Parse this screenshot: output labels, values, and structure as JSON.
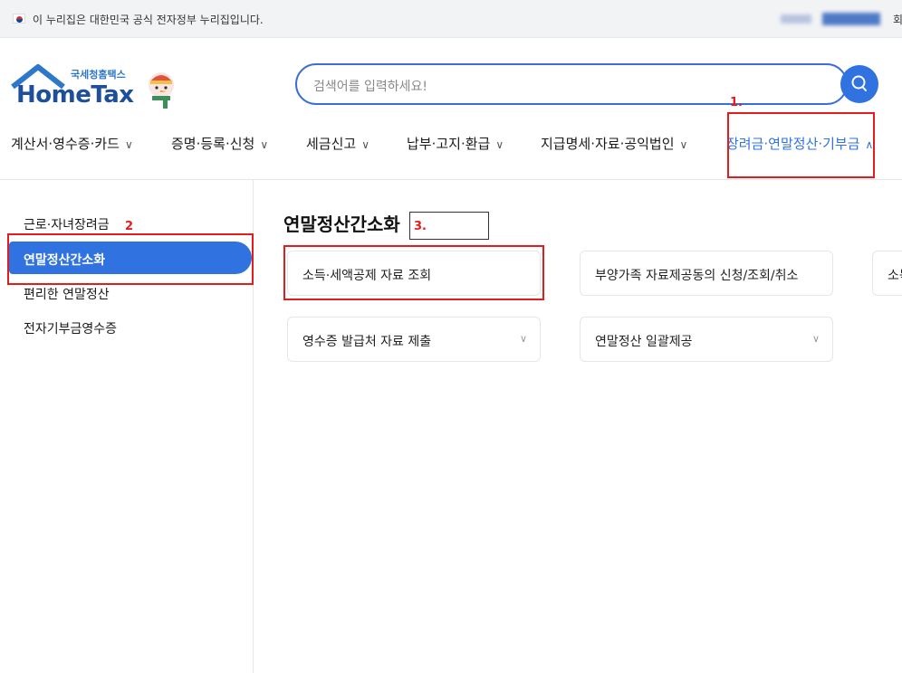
{
  "gov_banner": {
    "text": "이 누리집은 대한민국 공식 전자정부 누리집입니다.",
    "right_text": "회"
  },
  "logo": {
    "sub": "국세청홈택스",
    "main": "HomeTax"
  },
  "search": {
    "placeholder": "검색어를 입력하세요!"
  },
  "gnb": [
    {
      "label": "계산서·영수증·카드",
      "chevron": "∨"
    },
    {
      "label": "증명·등록·신청",
      "chevron": "∨"
    },
    {
      "label": "세금신고",
      "chevron": "∨"
    },
    {
      "label": "납부·고지·환급",
      "chevron": "∨"
    },
    {
      "label": "지급명세·자료·공익법인",
      "chevron": "∨"
    },
    {
      "label": "장려금·연말정산·기부금",
      "chevron": "∧"
    }
  ],
  "annotations": {
    "n1": "1.",
    "n2": "2",
    "n3": "3."
  },
  "lnb": [
    {
      "label": "근로·자녀장려금"
    },
    {
      "label": "연말정산간소화"
    },
    {
      "label": "편리한 연말정산"
    },
    {
      "label": "전자기부금영수증"
    }
  ],
  "main": {
    "title": "연말정산간소화",
    "cards": [
      {
        "label": "소득·세액공제 자료 조회"
      },
      {
        "label": "부양가족 자료제공동의 신청/조회/취소"
      },
      {
        "label": "소득"
      },
      {
        "label": "영수증 발급처 자료 제출",
        "chevron": "∨"
      },
      {
        "label": "연말정산 일괄제공",
        "chevron": "∨"
      }
    ]
  },
  "colors": {
    "accent": "#2f72e0",
    "annotation": "#e31c1c"
  }
}
